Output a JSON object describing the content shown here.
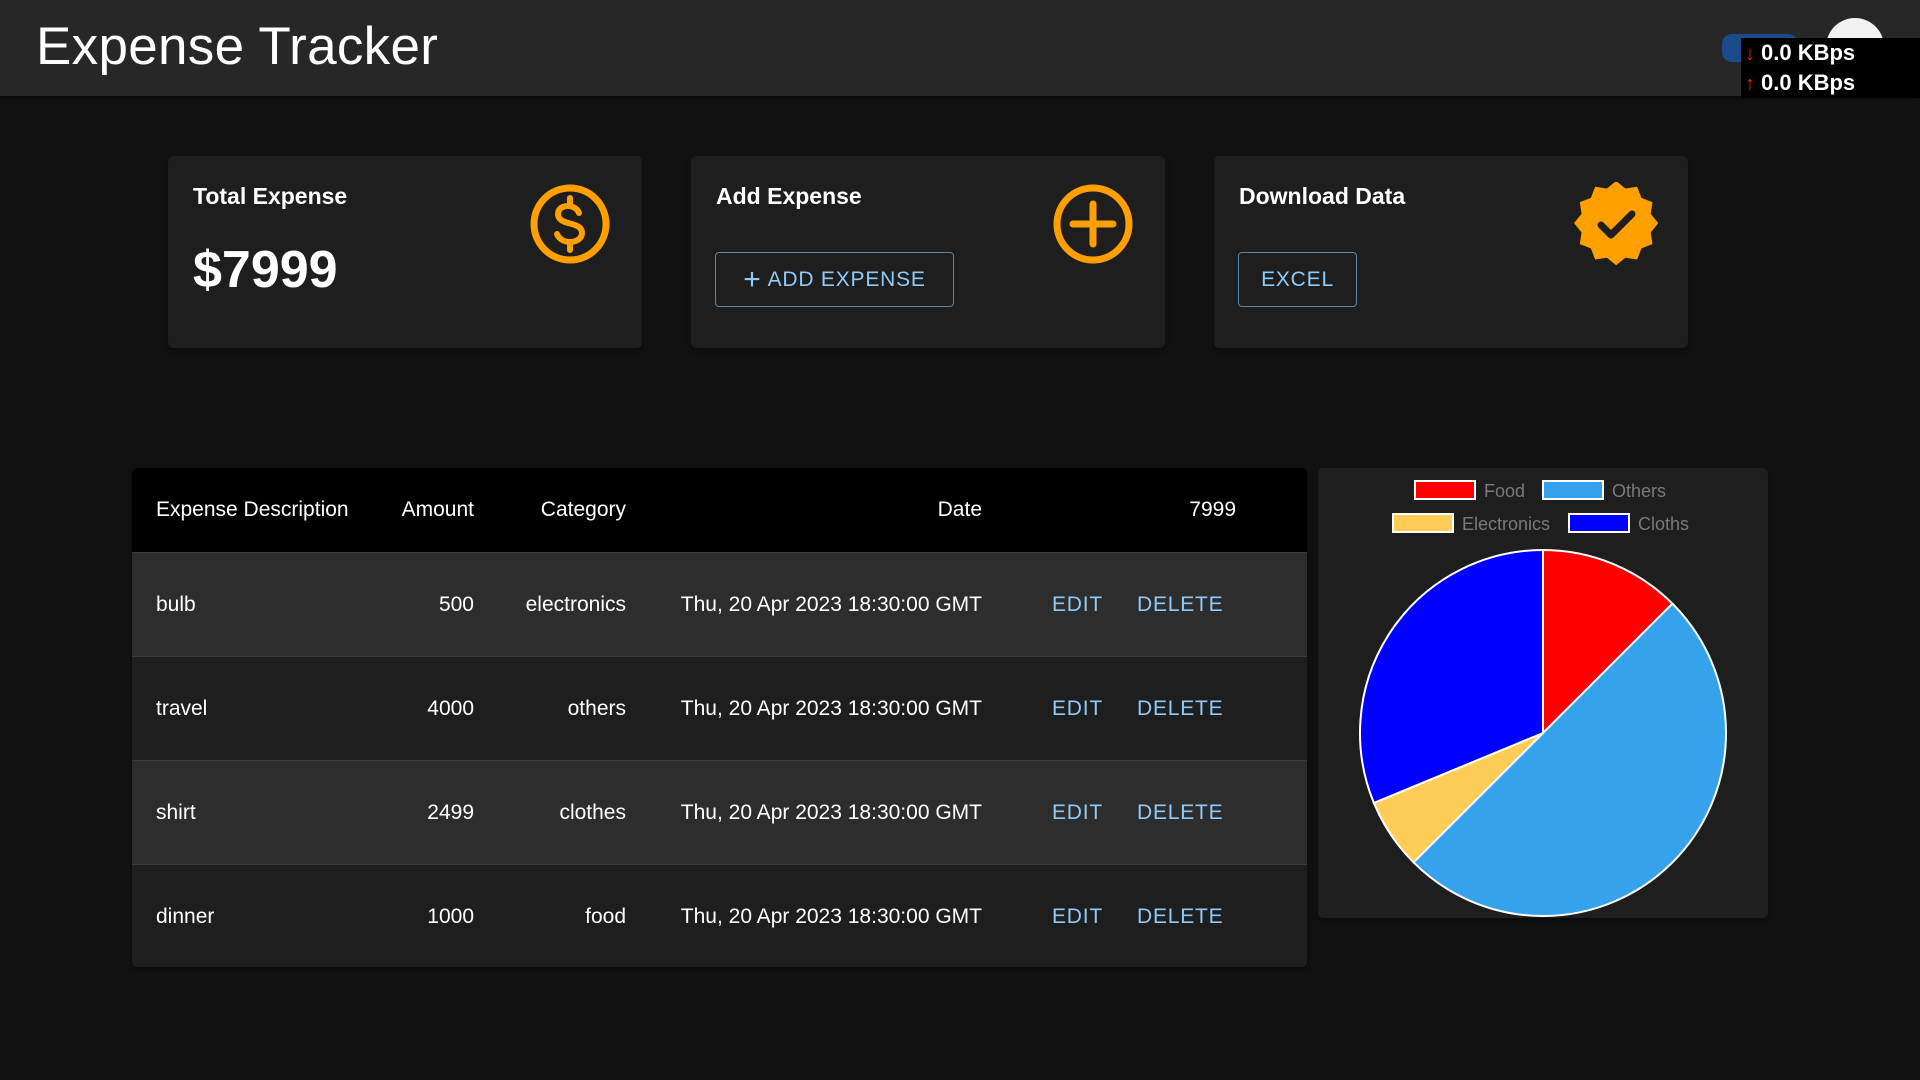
{
  "app": {
    "title": "Expense Tracker"
  },
  "tray": {
    "download_speed": "0.0 KBps",
    "upload_speed": "0.0 KBps"
  },
  "cards": {
    "total": {
      "title": "Total Expense",
      "amount": "$7999",
      "icon": "dollar-circle-icon"
    },
    "add": {
      "title": "Add Expense",
      "button_label": "ADD EXPENSE",
      "icon": "plus-circle-icon"
    },
    "download": {
      "title": "Download Data",
      "button_label": "EXCEL",
      "icon": "verified-badge-icon"
    }
  },
  "colors": {
    "accent_orange": "#ffa000",
    "button_blue": "#90caf9",
    "food": "#ff0000",
    "others": "#36a2eb",
    "electronics": "#ffcd56",
    "cloths": "#0000ff"
  },
  "table": {
    "headers": [
      "Expense Description",
      "Amount",
      "Category",
      "Date",
      "7999"
    ],
    "rows": [
      {
        "description": "bulb",
        "amount": "500",
        "category": "electronics",
        "date": "Thu, 20 Apr 2023 18:30:00 GMT",
        "edit": "EDIT",
        "delete": "DELETE"
      },
      {
        "description": "travel",
        "amount": "4000",
        "category": "others",
        "date": "Thu, 20 Apr 2023 18:30:00 GMT",
        "edit": "EDIT",
        "delete": "DELETE"
      },
      {
        "description": "shirt",
        "amount": "2499",
        "category": "clothes",
        "date": "Thu, 20 Apr 2023 18:30:00 GMT",
        "edit": "EDIT",
        "delete": "DELETE"
      },
      {
        "description": "dinner",
        "amount": "1000",
        "category": "food",
        "date": "Thu, 20 Apr 2023 18:30:00 GMT",
        "edit": "EDIT",
        "delete": "DELETE"
      }
    ]
  },
  "chart_data": {
    "type": "pie",
    "categories": [
      "Food",
      "Others",
      "Electronics",
      "Cloths"
    ],
    "values": [
      1000,
      4000,
      500,
      2499
    ],
    "colors": [
      "#ff0000",
      "#36a2eb",
      "#ffcd56",
      "#0000ff"
    ],
    "legend": "top"
  }
}
